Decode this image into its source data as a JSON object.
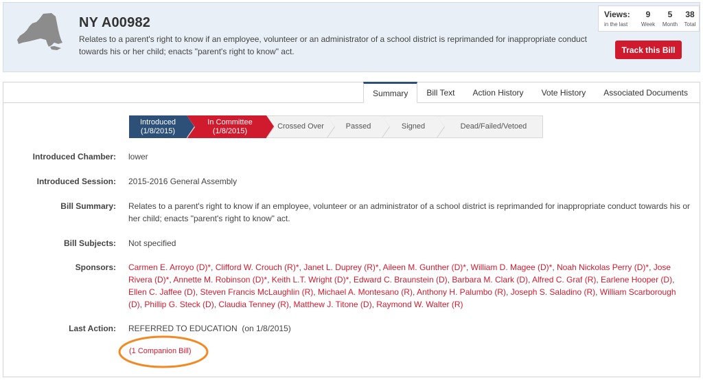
{
  "header": {
    "bill_id": "NY A00982",
    "description": "Relates to a parent's right to know if an employee, volunteer or an administrator of a school district is reprimanded for inappropriate conduct towards his or her child; enacts \"parent's right to know\" act.",
    "views": {
      "label": "Views:",
      "sub": "in the last",
      "week": {
        "num": "9",
        "lbl": "Week"
      },
      "month": {
        "num": "5",
        "lbl": "Month"
      },
      "total": {
        "num": "38",
        "lbl": "Total"
      }
    },
    "track_label": "Track this Bill"
  },
  "tabs": [
    "Summary",
    "Bill Text",
    "Action History",
    "Vote History",
    "Associated Documents"
  ],
  "progress": [
    {
      "label": "Introduced",
      "date": "(1/8/2015)"
    },
    {
      "label": "In Committee",
      "date": "(1/8/2015)"
    },
    {
      "label": "Crossed Over",
      "date": ""
    },
    {
      "label": "Passed",
      "date": ""
    },
    {
      "label": "Signed",
      "date": ""
    },
    {
      "label": "Dead/Failed/Vetoed",
      "date": ""
    }
  ],
  "details": {
    "chamber_key": "Introduced Chamber:",
    "chamber_val": "lower",
    "session_key": "Introduced Session:",
    "session_val": "2015-2016 General Assembly",
    "summary_key": "Bill Summary:",
    "summary_val": "Relates to a parent's right to know if an employee, volunteer or an administrator of a school district is reprimanded for inappropriate conduct towards his or her child; enacts \"parent's right to know\" act.",
    "subjects_key": "Bill Subjects:",
    "subjects_val": "Not specified",
    "sponsors_key": "Sponsors:",
    "sponsors": [
      "Carmen E. Arroyo (D)*",
      "Clifford W. Crouch (R)*",
      "Janet L. Duprey (R)*",
      "Aileen M. Gunther (D)*",
      "William D. Magee (D)*",
      "Noah Nickolas Perry (D)*",
      "Jose Rivera (D)*",
      "Annette M. Robinson (D)*",
      "Keith L.T. Wright (D)*",
      "Edward C. Braunstein (D)",
      "Barbara M. Clark (D)",
      "Alfred C. Graf (R)",
      "Earlene Hooper (D)",
      "Ellen C. Jaffee (D)",
      "Steven Francis McLaughlin (R)",
      "Michael A. Montesano (R)",
      "Anthony H. Palumbo (R)",
      "Joseph S. Saladino (R)",
      "William Scarborough (D)",
      "Phillip G. Steck (D)",
      "Claudia Tenney (R)",
      "Matthew J. Titone (D)",
      "Raymond W. Walter (R)"
    ],
    "last_action_key": "Last Action:",
    "last_action_val": "REFERRED TO EDUCATION  (on 1/8/2015)",
    "companion": "(1 Companion Bill)"
  },
  "colors": {
    "accent_red": "#d01a2e",
    "accent_navy": "#2c5078",
    "annotation_orange": "#f08a24"
  }
}
